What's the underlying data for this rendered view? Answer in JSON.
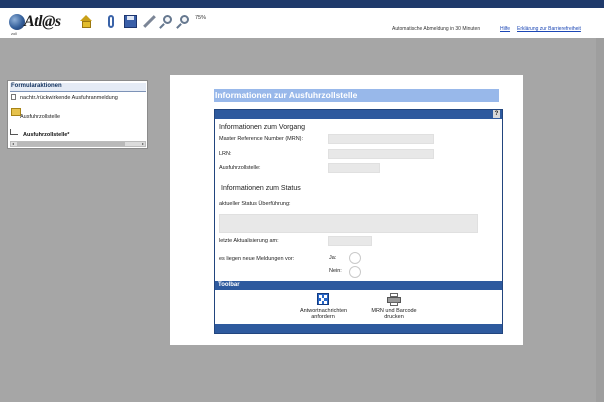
{
  "header": {
    "logo_text": "Atl@s",
    "logo_sub": "zoll",
    "zoom_level": "75%",
    "auto_logout": "Automatische Abmeldung in 30 Minuten",
    "help_link": "Hilfe",
    "accessibility_link": "Erklärung zur Barrierefreiheit",
    "toolbar_icons": [
      "home-icon",
      "paperclip-icon",
      "save-icon",
      "pen-icon",
      "zoom-out-icon",
      "zoom-in-icon"
    ]
  },
  "sidebar": {
    "title": "Formularaktionen",
    "action_item": "nachtr./rückwirkende Ausfuhranmeldung",
    "folder_label": "Ausfuhrzollstelle",
    "current_item": "Ausfuhrzollstelle*"
  },
  "form": {
    "title": "Informationen zur Ausfuhrzollstelle",
    "help_label": "?",
    "section_vorgang": "Informationen zum Vorgang",
    "mrn_label": "Master Reference Number (MRN):",
    "mrn_value": "",
    "lrn_label": "LRN:",
    "lrn_value": "",
    "ausfuhrzollstelle_label": "Ausfuhrzollstelle:",
    "ausfuhrzollstelle_value": "",
    "section_status": "Informationen zum Status",
    "status_label": "aktueller Status Überführung:",
    "status_value": "",
    "last_update_label": "letzte Aktualisierung am:",
    "last_update_value": "",
    "new_messages_label": "es liegen neue Meldungen vor:",
    "option_yes": "Ja:",
    "option_no": "Nein:",
    "toolbar_title": "Toolbar",
    "btn_answers": [
      "Antwortnachrichten",
      "anfordern"
    ],
    "btn_print": [
      "MRN und Barcode",
      "drucken"
    ]
  },
  "colors": {
    "header_strip": "#1f3a6b",
    "form_bar": "#2e5a9e",
    "title_bar": "#98b8ea",
    "background": "#a6a6a6"
  }
}
